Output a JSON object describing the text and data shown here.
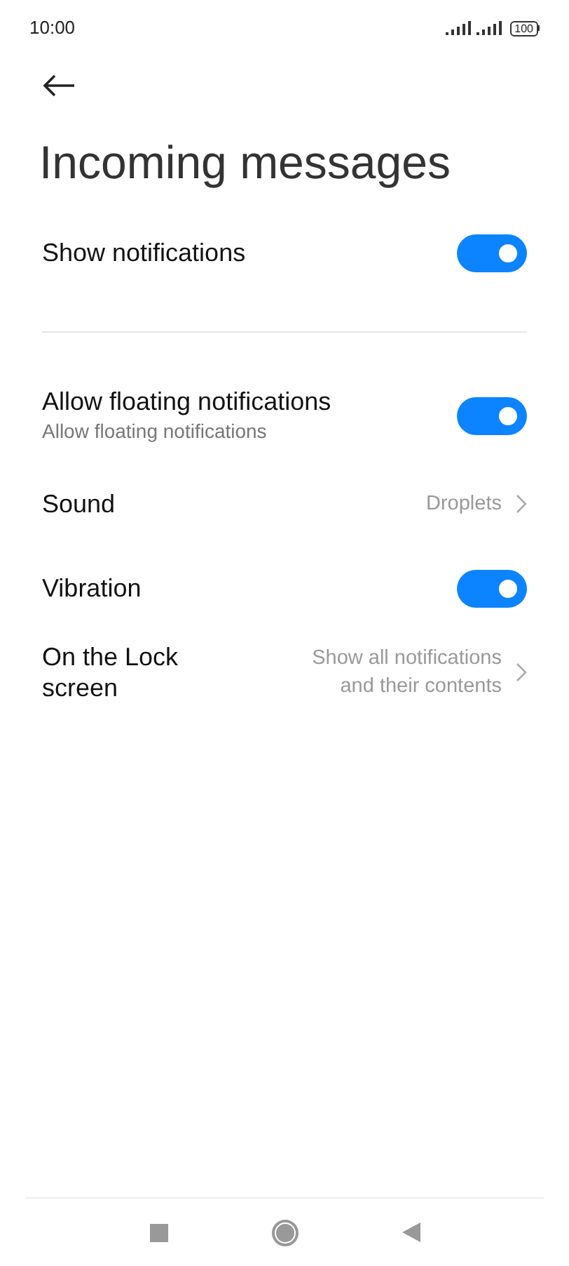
{
  "status_bar": {
    "time": "10:00",
    "battery": "100"
  },
  "title": "Incoming messages",
  "sections": [
    {
      "items": [
        {
          "kind": "toggle",
          "label": "Show notifications",
          "on": true
        }
      ]
    },
    {
      "items": [
        {
          "kind": "toggle",
          "label": "Allow floating notifications",
          "subtitle": "Allow floating notifications",
          "on": true
        },
        {
          "kind": "link",
          "label": "Sound",
          "value": "Droplets"
        },
        {
          "kind": "toggle",
          "label": "Vibration",
          "on": true
        },
        {
          "kind": "link",
          "label": "On the Lock screen",
          "value": "Show all notifications and their contents"
        }
      ]
    }
  ]
}
